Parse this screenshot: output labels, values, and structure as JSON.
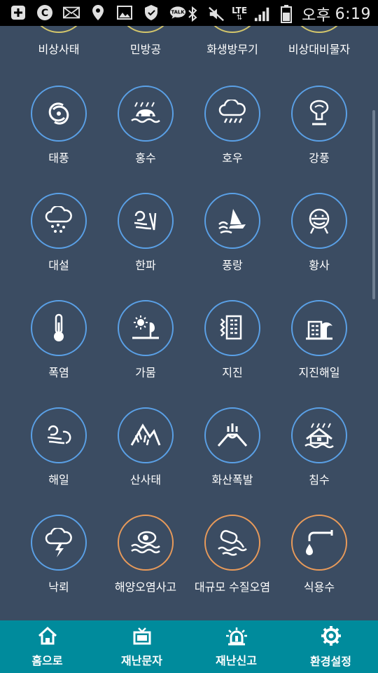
{
  "status_bar": {
    "lte": "LTE",
    "ampm": "오후",
    "time": "6:19",
    "icons": [
      "plus-icon",
      "c-badge-icon",
      "mail-icon",
      "location-icon",
      "image-icon",
      "shield-icon",
      "talk-icon",
      "bluetooth-icon",
      "mute-icon",
      "signal-icon",
      "battery-icon"
    ],
    "talk_text": "TALK"
  },
  "top_row_labels": [
    "비상사태",
    "민방공",
    "화생방무기",
    "비상대비물자"
  ],
  "grid": [
    {
      "label": "태풍",
      "icon": "typhoon-icon",
      "border": "blue"
    },
    {
      "label": "홍수",
      "icon": "flood-icon",
      "border": "blue"
    },
    {
      "label": "호우",
      "icon": "heavy-rain-icon",
      "border": "blue"
    },
    {
      "label": "강풍",
      "icon": "strong-wind-icon",
      "border": "blue"
    },
    {
      "label": "대설",
      "icon": "heavy-snow-icon",
      "border": "blue"
    },
    {
      "label": "한파",
      "icon": "cold-wave-icon",
      "border": "blue"
    },
    {
      "label": "풍랑",
      "icon": "high-waves-icon",
      "border": "blue"
    },
    {
      "label": "황사",
      "icon": "yellow-dust-icon",
      "border": "blue"
    },
    {
      "label": "폭염",
      "icon": "heat-wave-icon",
      "border": "blue"
    },
    {
      "label": "가뭄",
      "icon": "drought-icon",
      "border": "blue"
    },
    {
      "label": "지진",
      "icon": "earthquake-icon",
      "border": "blue"
    },
    {
      "label": "지진해일",
      "icon": "tsunami-icon",
      "border": "blue"
    },
    {
      "label": "해일",
      "icon": "storm-surge-icon",
      "border": "blue"
    },
    {
      "label": "산사태",
      "icon": "landslide-icon",
      "border": "blue"
    },
    {
      "label": "화산폭발",
      "icon": "volcano-icon",
      "border": "blue"
    },
    {
      "label": "침수",
      "icon": "inundation-icon",
      "border": "blue"
    },
    {
      "label": "낙뢰",
      "icon": "lightning-icon",
      "border": "blue"
    },
    {
      "label": "해양오염사고",
      "icon": "marine-pollution-icon",
      "border": "orange"
    },
    {
      "label": "대규모 수질오염",
      "icon": "water-pollution-icon",
      "border": "orange"
    },
    {
      "label": "식용수",
      "icon": "drinking-water-icon",
      "border": "orange"
    }
  ],
  "bottom_nav": [
    {
      "label": "홈으로",
      "icon": "home-icon"
    },
    {
      "label": "재난문자",
      "icon": "tv-icon"
    },
    {
      "label": "재난신고",
      "icon": "siren-icon"
    },
    {
      "label": "환경설정",
      "icon": "gear-icon"
    }
  ],
  "colors": {
    "background": "#3b4c62",
    "circle_blue": "#5aa0e6",
    "circle_orange": "#e89a5a",
    "nav": "#008b9c"
  }
}
